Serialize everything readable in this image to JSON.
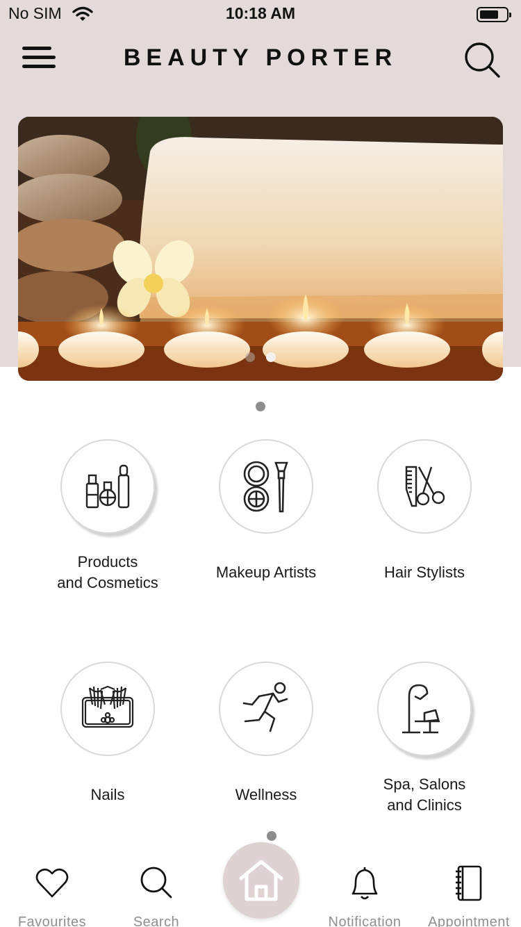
{
  "status_bar": {
    "carrier": "No SIM",
    "time": "10:18 AM",
    "wifi_icon": "wifi-icon",
    "battery_icon": "battery-icon"
  },
  "header": {
    "title": "BEAUTY PORTER",
    "menu_icon": "hamburger-menu-icon",
    "search_icon": "search-icon"
  },
  "banner": {
    "image": "spa-candles-towel-stones",
    "slide_count": 2,
    "active_slide": 2
  },
  "categories": [
    {
      "line1": "Products",
      "line2": "and Cosmetics",
      "icon": "cosmetics-icon"
    },
    {
      "line1": "Makeup Artists",
      "line2": "",
      "icon": "makeup-brush-icon"
    },
    {
      "line1": "Hair Stylists",
      "line2": "",
      "icon": "comb-scissors-icon"
    },
    {
      "line1": "Nails",
      "line2": "",
      "icon": "nails-hands-icon"
    },
    {
      "line1": "Wellness",
      "line2": "",
      "icon": "running-person-icon"
    },
    {
      "line1": "Spa, Salons",
      "line2": "and Clinics",
      "icon": "salon-chair-icon"
    }
  ],
  "tabbar": {
    "items": [
      {
        "label": "Favourites",
        "icon": "heart-icon"
      },
      {
        "label": "Search",
        "icon": "search-icon"
      },
      {
        "label": "",
        "icon": "home-icon"
      },
      {
        "label": "Notification",
        "icon": "bell-icon"
      },
      {
        "label": "Appointment",
        "icon": "notebook-icon"
      }
    ]
  },
  "colors": {
    "header_bg": "#e3dad9",
    "home_button_bg": "#dfd2d2",
    "tab_label": "#8f8f8f",
    "indicator": "#8d8d8d"
  }
}
